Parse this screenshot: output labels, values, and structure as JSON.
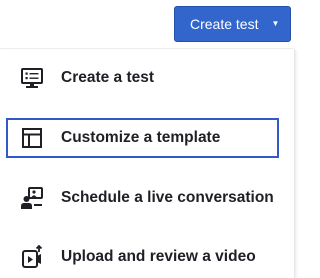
{
  "header": {
    "create_button_label": "Create test",
    "create_button_caret_icon": "caret-down-icon"
  },
  "menu": {
    "items": [
      {
        "label": "Create a test",
        "icon": "monitor-checklist-icon",
        "selected": false
      },
      {
        "label": "Customize a template",
        "icon": "template-layout-icon",
        "selected": true
      },
      {
        "label": "Schedule a live conversation",
        "icon": "live-conversation-icon",
        "selected": false
      },
      {
        "label": "Upload and review a video",
        "icon": "upload-video-icon",
        "selected": false
      }
    ]
  },
  "colors": {
    "primary": "#3366cc",
    "selection_border": "#2f5ac8",
    "text": "#1e2026",
    "icon": "#1e2026"
  }
}
